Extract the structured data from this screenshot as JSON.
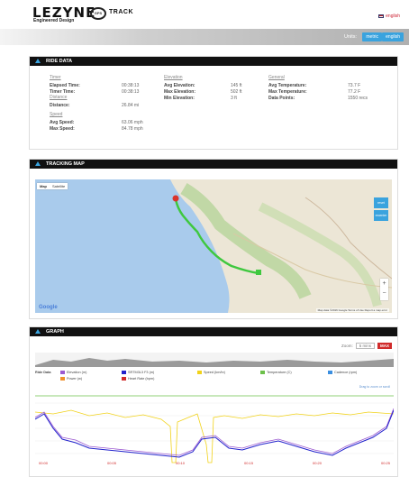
{
  "header": {
    "logo_text": "LEZYNE",
    "logo_subtitle": "Engineered Design",
    "logo_badge": "GPS",
    "product": "TRACK",
    "language": "english"
  },
  "units": {
    "label": "Units:",
    "metric": "metric",
    "english": "english"
  },
  "ride_data": {
    "title": "RIDE DATA",
    "timer": {
      "heading": "Timer",
      "rows": [
        {
          "label": "Elapsed Time:",
          "value": "00:38:13"
        },
        {
          "label": "Timer Time:",
          "value": "00:38:13"
        }
      ]
    },
    "distance": {
      "heading": "Distance",
      "rows": [
        {
          "label": "Distance:",
          "value": "26.84 mi"
        }
      ]
    },
    "speed": {
      "heading": "Speed",
      "rows": [
        {
          "label": "Avg Speed:",
          "value": "63.06 mph"
        },
        {
          "label": "Max Speed:",
          "value": "84.78 mph"
        }
      ]
    },
    "elevation": {
      "heading": "Elevation",
      "rows": [
        {
          "label": "Avg Elevation:",
          "value": "145 ft"
        },
        {
          "label": "Max Elevation:",
          "value": "502 ft"
        },
        {
          "label": "Min Elevation:",
          "value": "3 ft"
        }
      ]
    },
    "general": {
      "heading": "General",
      "rows": [
        {
          "label": "Avg Temperature:",
          "value": "73.7 F"
        },
        {
          "label": "Max Temperature:",
          "value": "77.2 F"
        },
        {
          "label": "Data Points:",
          "value": "1550 recs"
        }
      ]
    }
  },
  "tracking_map": {
    "title": "TRACKING MAP",
    "map_type": [
      "Map",
      "Satellite"
    ],
    "reset": "reset",
    "recenter": "recenter",
    "zoom_in": "+",
    "zoom_out": "−",
    "google": "Google",
    "map_data": "Map data ©2016 Google   Terms of Use   Report a map error",
    "colors": {
      "route": "#3fc83f",
      "start": "#d9342b",
      "end": "#3fc83f"
    }
  },
  "graph": {
    "title": "GRAPH",
    "zoom_label": "Zoom:",
    "zoom_value": "5 mins",
    "max_label": "MAX",
    "legend_title": "Ride Data",
    "legend": [
      {
        "name": "Elevation (m)",
        "color": "#9b59d0"
      },
      {
        "name": "SRTM3L3 F3 (m)",
        "color": "#2222cc"
      },
      {
        "name": "Speed (km/hr)",
        "color": "#f1d21a"
      },
      {
        "name": "Temperature (C)",
        "color": "#6cc04a"
      },
      {
        "name": "Cadence (rpm)",
        "color": "#3b8fe0"
      },
      {
        "name": "Power (w)",
        "color": "#f0902c"
      },
      {
        "name": "Heart Rate (bpm)",
        "color": "#d02b2b"
      }
    ],
    "hint": "Drag to zoom or scroll",
    "x_ticks": [
      "00:00",
      "00:05",
      "00:10",
      "00:15",
      "00:20",
      "00:25"
    ]
  }
}
